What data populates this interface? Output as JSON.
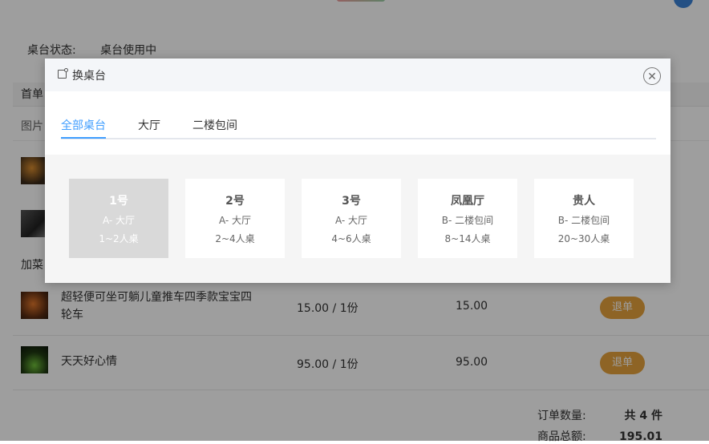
{
  "status": {
    "label": "桌台状态:",
    "value": "桌台使用中"
  },
  "sections": {
    "first": "首单",
    "image_col": "图片",
    "add": "加菜"
  },
  "orders": [
    {
      "name": "超轻便可坐可躺儿童推车四季款宝宝四轮车",
      "price": "15.00 / 1份",
      "subtotal": "15.00",
      "action": "退单"
    },
    {
      "name": "天天好心情",
      "price": "95.00 / 1份",
      "subtotal": "95.00",
      "action": "退单"
    }
  ],
  "summary": {
    "count_label": "订单数量:",
    "count_value": "共 4 件",
    "total_label": "商品总额:",
    "total_value": "195.01"
  },
  "dialog": {
    "title": "换桌台",
    "close_icon": "close-circle-icon",
    "tabs": [
      {
        "label": "全部桌台",
        "active": true
      },
      {
        "label": "大厅"
      },
      {
        "label": "二楼包间"
      }
    ],
    "tables": [
      {
        "name": "1号",
        "area": "A- 大厅",
        "capacity": "1~2人桌",
        "selected": true
      },
      {
        "name": "2号",
        "area": "A- 大厅",
        "capacity": "2~4人桌"
      },
      {
        "name": "3号",
        "area": "A- 大厅",
        "capacity": "4~6人桌"
      },
      {
        "name": "凤凰厅",
        "area": "B- 二楼包间",
        "capacity": "8~14人桌"
      },
      {
        "name": "贵人",
        "area": "B- 二楼包间",
        "capacity": "20~30人桌"
      }
    ]
  },
  "colors": {
    "accent": "#409eff",
    "refund": "#e6a23c",
    "selected_card": "#d9d9d9"
  }
}
